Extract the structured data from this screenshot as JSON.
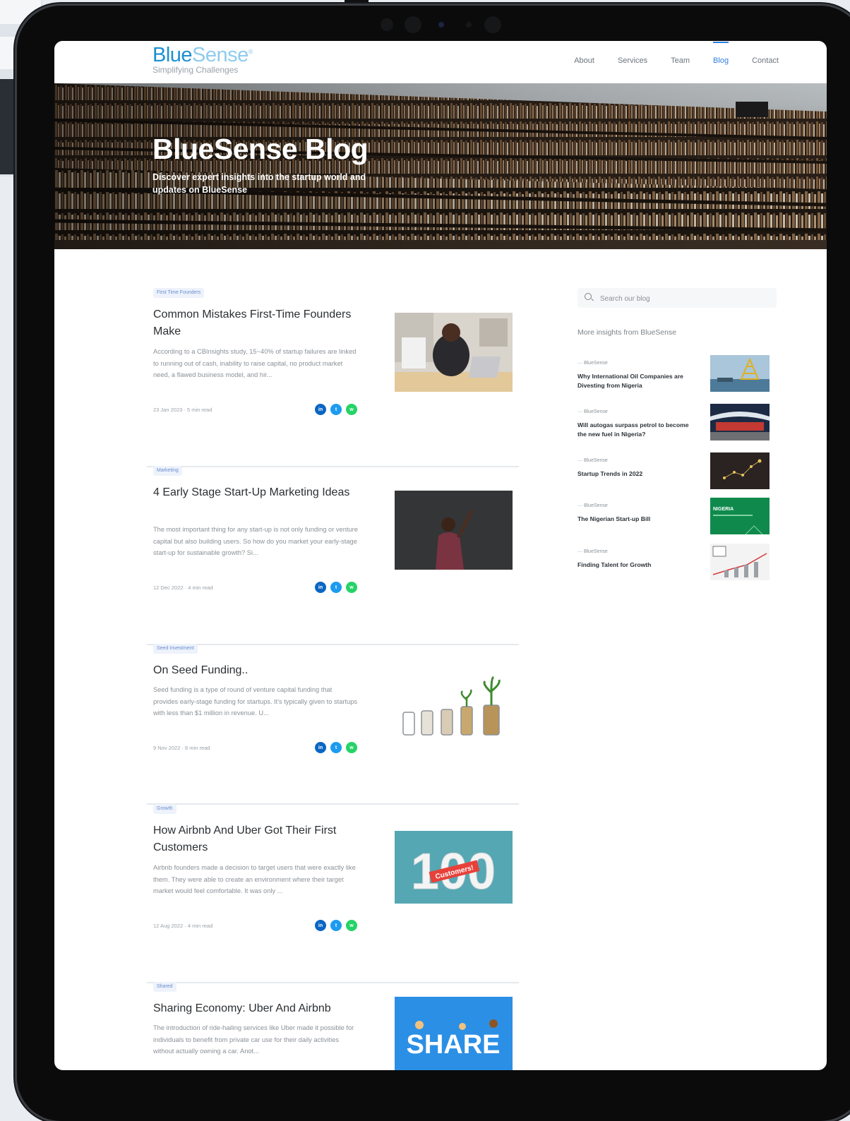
{
  "site": {
    "logo_primary": "Blue",
    "logo_secondary": "Sense",
    "logo_mark": "®",
    "tagline": "Simplifying Challenges"
  },
  "nav": [
    {
      "label": "About",
      "active": false
    },
    {
      "label": "Services",
      "active": false
    },
    {
      "label": "Team",
      "active": false
    },
    {
      "label": "Blog",
      "active": true
    },
    {
      "label": "Contact",
      "active": false
    }
  ],
  "hero": {
    "title": "BlueSense Blog",
    "subtitle": "Discover expert insights into the startup world and updates on BlueSense"
  },
  "posts": [
    {
      "tag": "First Time Founders",
      "title": "Common Mistakes First-Time Founders Make",
      "excerpt": "According to a CBInsights study, 15~40% of startup failures are linked to running out of cash, inability to raise capital, no product market need, a flawed business model, and hir...",
      "date": "23 Jan 2023",
      "read": "5 min read"
    },
    {
      "tag": "Marketing",
      "title": "4 Early Stage Start-Up Marketing Ideas",
      "excerpt": "The most important thing for any start-up is not only funding or venture capital but also building users. So how do you market your early-stage start-up for sustainable growth? Si...",
      "date": "12 Dec 2022",
      "read": "4 min read"
    },
    {
      "tag": "Seed Investment",
      "title": "On Seed Funding..",
      "excerpt": "Seed funding is a type of round of venture capital funding that provides early-stage funding for startups. It's typically given to startups with less than $1 million in revenue. U...",
      "date": "9 Nov 2022",
      "read": "8 min read"
    },
    {
      "tag": "Growth",
      "title": "How Airbnb And Uber Got Their First Customers",
      "excerpt": "Airbnb founders made a decision to target users that were exactly like them. They were able to create an environment where their target market would feel comfortable. It was only ...",
      "date": "12 Aug 2022",
      "read": "4 min read",
      "thumb_number": "100",
      "thumb_ribbon": "Customers!"
    },
    {
      "tag": "Shared",
      "title": "Sharing Economy: Uber And Airbnb",
      "excerpt": "The introduction of ride-hailing services like Uber made it possible for individuals to benefit from private car use for their daily activities without actually owning a car. Anot...",
      "thumb_word": "SHARE"
    }
  ],
  "share_icons": [
    "linkedin-icon",
    "twitter-icon",
    "whatsapp-icon"
  ],
  "sidebar": {
    "search_placeholder": "Search our blog",
    "heading": "More insights from BlueSense",
    "items": [
      {
        "author": "BlueSense",
        "title": "Why International Oil Companies are Divesting from Nigeria"
      },
      {
        "author": "BlueSense",
        "title": "Will autogas surpass petrol to become the new fuel in Nigeria?"
      },
      {
        "author": "BlueSense",
        "title": "Startup Trends in 2022"
      },
      {
        "author": "BlueSense",
        "title": "The Nigerian Start-up Bill",
        "thumb_label": "NIGERIA"
      },
      {
        "author": "BlueSense",
        "title": "Finding Talent for Growth"
      }
    ]
  },
  "colors": {
    "brand_blue": "#1b8fd2",
    "nav_active": "#2f7fe0",
    "linkedin": "#0a66c2",
    "twitter": "#1d9bf0",
    "whatsapp": "#25d366"
  }
}
